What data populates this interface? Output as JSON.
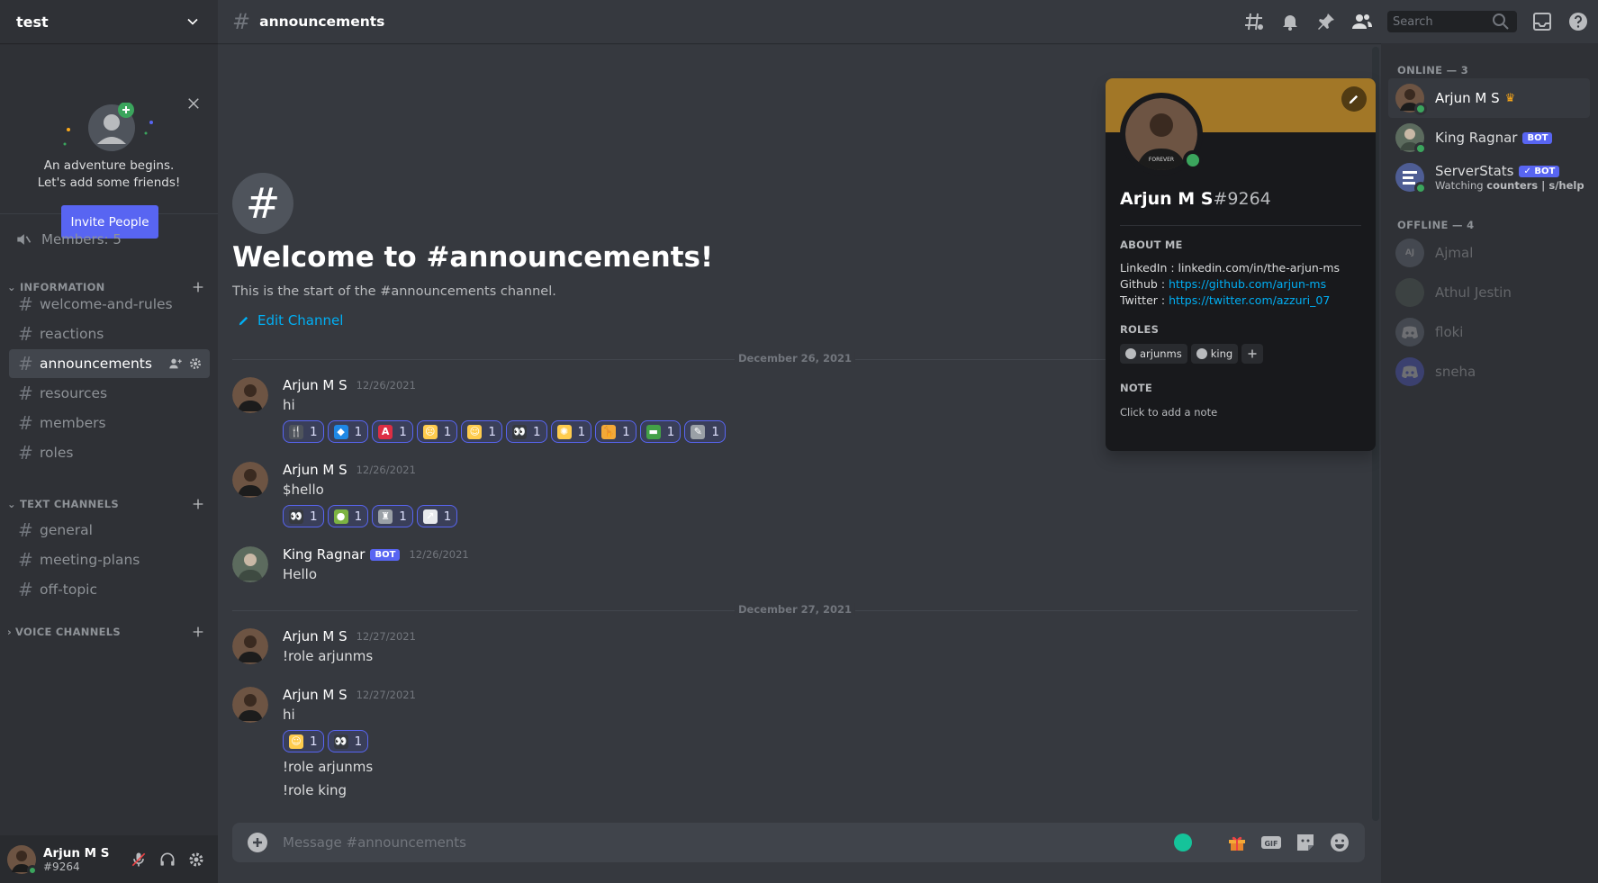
{
  "server": {
    "name": "test"
  },
  "invite_card": {
    "line1": "An adventure begins.",
    "line2": "Let's add some friends!",
    "button": "Invite People"
  },
  "members_row": "Members: 5",
  "categories": {
    "information": "INFORMATION",
    "text_channels": "TEXT CHANNELS",
    "voice_channels": "VOICE CHANNELS"
  },
  "channels": {
    "information": [
      "welcome-and-rules",
      "reactions",
      "announcements",
      "resources",
      "members",
      "roles"
    ],
    "text": [
      "general",
      "meeting-plans",
      "off-topic"
    ]
  },
  "current_user": {
    "name": "Arjun M S",
    "tag": "#9264"
  },
  "topbar": {
    "channel": "announcements",
    "search_placeholder": "Search"
  },
  "welcome": {
    "icon": "#",
    "title": "Welcome to #announcements!",
    "subtitle": "This is the start of the #announcements channel.",
    "edit": "Edit Channel"
  },
  "dividers": [
    "December 26, 2021",
    "December 27, 2021"
  ],
  "messages": [
    {
      "author": "Arjun M S",
      "time": "12/26/2021",
      "text": "hi",
      "reactions": [
        {
          "emoji": "fork-knife",
          "count": "1",
          "color": "#4f545c",
          "glyph": "🍴"
        },
        {
          "emoji": "diamond",
          "count": "1",
          "color": "#1e88e5",
          "glyph": "◆"
        },
        {
          "emoji": "a-button",
          "count": "1",
          "color": "#dd2e44",
          "glyph": "A"
        },
        {
          "emoji": "weary-face",
          "count": "1",
          "color": "#ffcc4d",
          "glyph": "☹"
        },
        {
          "emoji": "yum-face",
          "count": "1",
          "color": "#ffcc4d",
          "glyph": "☺"
        },
        {
          "emoji": "eyes",
          "count": "1",
          "color": "#36393f",
          "glyph": "👀"
        },
        {
          "emoji": "exploding-head",
          "count": "1",
          "color": "#ffcc4d",
          "glyph": "✺"
        },
        {
          "emoji": "giraffe",
          "count": "1",
          "color": "#f4a937",
          "glyph": "🦒"
        },
        {
          "emoji": "flag",
          "count": "1",
          "color": "#43a047",
          "glyph": "▬"
        },
        {
          "emoji": "knife",
          "count": "1",
          "color": "#9aa0a6",
          "glyph": "✎"
        }
      ]
    },
    {
      "author": "Arjun M S",
      "time": "12/26/2021",
      "text": "$hello",
      "reactions": [
        {
          "emoji": "eyes",
          "count": "1",
          "color": "#36393f",
          "glyph": "👀"
        },
        {
          "emoji": "avocado",
          "count": "1",
          "color": "#7cb342",
          "glyph": "●"
        },
        {
          "emoji": "trophy",
          "count": "1",
          "color": "#9aa0a6",
          "glyph": "♜"
        },
        {
          "emoji": "chart-increasing",
          "count": "1",
          "color": "#e8eaed",
          "glyph": "↗"
        }
      ]
    },
    {
      "author": "King Ragnar",
      "badge": "BOT",
      "time": "12/26/2021",
      "text": "Hello"
    },
    {
      "author": "Arjun M S",
      "time": "12/27/2021",
      "text": "!role arjunms"
    },
    {
      "author": "Arjun M S",
      "time": "12/27/2021",
      "text": "hi",
      "reactions": [
        {
          "emoji": "grin",
          "count": "1",
          "color": "#ffcc4d",
          "glyph": "☺"
        },
        {
          "emoji": "eyes",
          "count": "1",
          "color": "#36393f",
          "glyph": "👀"
        }
      ],
      "followups": [
        "!role arjunms",
        "!role king"
      ]
    }
  ],
  "composer": {
    "placeholder": "Message #announcements",
    "gif": "GIF"
  },
  "profile": {
    "name": "Arjun M S",
    "tag": "#9264",
    "about_title": "ABOUT ME",
    "about": [
      {
        "label": "LinkedIn : ",
        "value": "linkedin.com/in/the-arjun-ms",
        "link": false
      },
      {
        "label": "Github : ",
        "value": "https://github.com/arjun-ms",
        "link": true
      },
      {
        "label": "Twitter : ",
        "value": "https://twitter.com/azzuri_07",
        "link": true
      }
    ],
    "roles_title": "ROLES",
    "roles": [
      "arjunms",
      "king"
    ],
    "note_title": "NOTE",
    "note_placeholder": "Click to add a note",
    "banner_color": "#a27727"
  },
  "member_list": {
    "online_header": "ONLINE — 3",
    "offline_header": "OFFLINE — 4",
    "online": [
      {
        "name": "Arjun M S",
        "crown": "♛"
      },
      {
        "name": "King Ragnar",
        "badge": "BOT"
      },
      {
        "name": "ServerStats",
        "badge": "✓ BOT",
        "status_prefix": "Watching ",
        "status_bold": "counters | s/help"
      }
    ],
    "offline": [
      "Ajmal",
      "Athul Jestin",
      "floki",
      "sneha"
    ]
  },
  "colors": {
    "blurple": "#5865f2",
    "online": "#3ba55d",
    "link": "#00aff4"
  }
}
